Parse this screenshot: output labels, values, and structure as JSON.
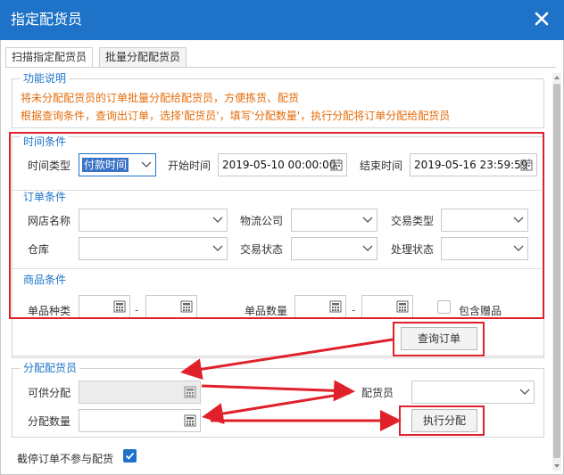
{
  "dialog": {
    "title": "指定配货员"
  },
  "tabs": [
    {
      "label": "扫描指定配货员"
    },
    {
      "label": "批量分配配货员"
    }
  ],
  "function_desc": {
    "legend": "功能说明",
    "line1": "将未分配配货员的订单批量分配给配货员，方便拣货、配货",
    "line2": "根据查询条件，查询出订单，选择'配货员'，填写'分配数量'，执行分配将订单分配给配货员"
  },
  "time_cond": {
    "legend": "时间条件",
    "type_label": "时间类型",
    "type_value": "付款时间",
    "start_label": "开始时间",
    "start_value": "2019-05-10 00:00:00",
    "end_label": "结束时间",
    "end_value": "2019-05-16 23:59:59"
  },
  "order_cond": {
    "legend": "订单条件",
    "shop_label": "网店名称",
    "logistics_label": "物流公司",
    "trade_type_label": "交易类型",
    "warehouse_label": "仓库",
    "trade_status_label": "交易状态",
    "process_status_label": "处理状态"
  },
  "goods_cond": {
    "legend": "商品条件",
    "sku_kinds_label": "单品种类",
    "sku_qty_label": "单品数量",
    "range_sep": "-",
    "include_gift_label": "包含赠品",
    "include_gift_checked": false
  },
  "query_button": "查询订单",
  "assign": {
    "legend": "分配配货员",
    "available_label": "可供分配",
    "picker_label": "配货员",
    "quantity_label": "分配数量",
    "execute_button": "执行分配"
  },
  "footer": {
    "pause_label": "截停订单不参与配货",
    "pause_checked": true
  },
  "colors": {
    "header_bg": "#1e73c9",
    "accent": "#1e73c9",
    "desc_text": "#e46c0a",
    "annotation_red": "#e0212b"
  }
}
